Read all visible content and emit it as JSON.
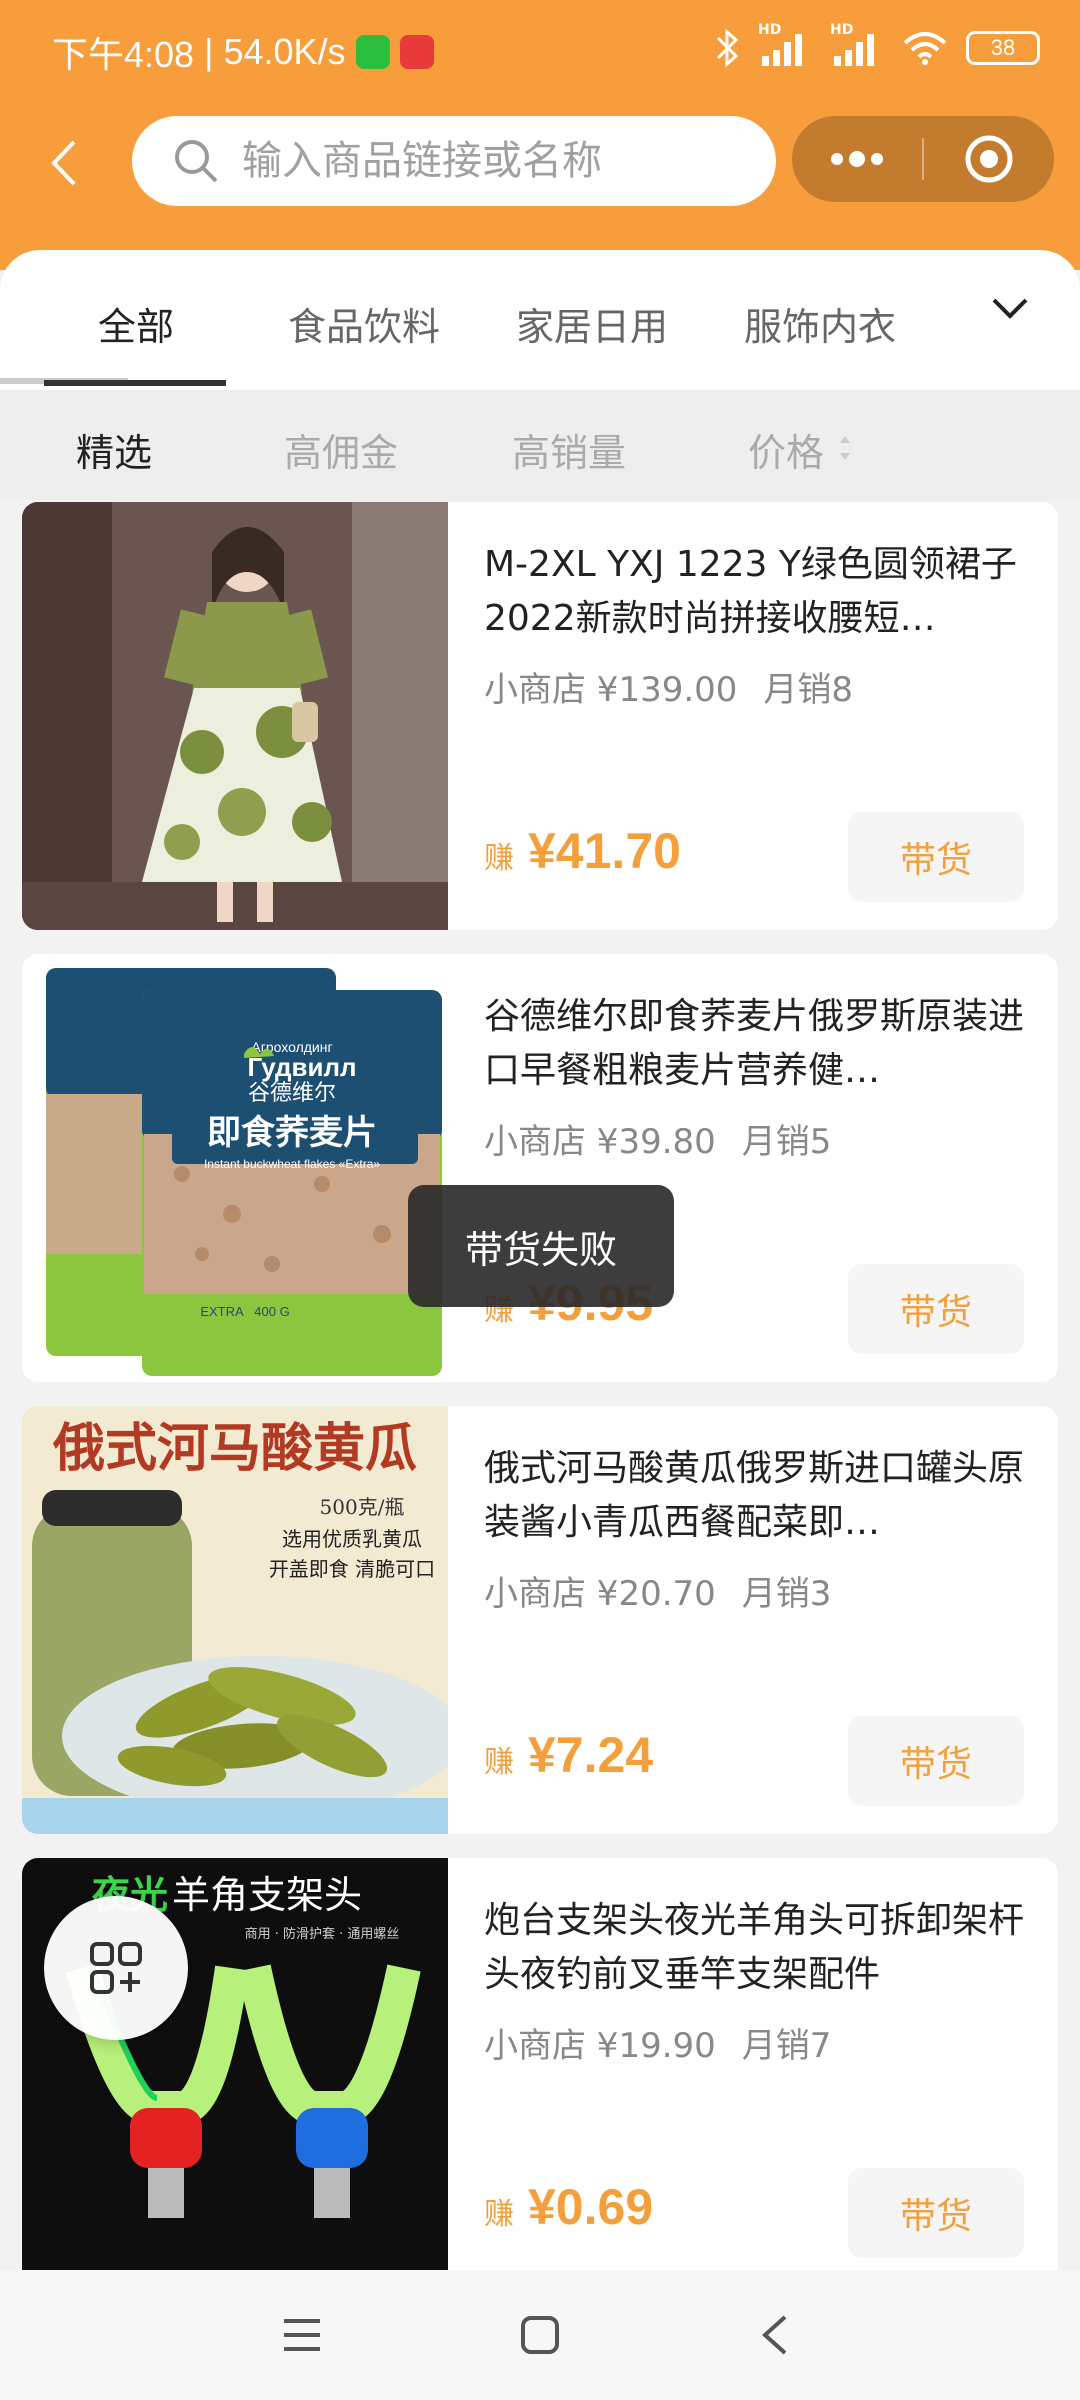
{
  "status_bar": {
    "time": "下午4:08",
    "separator": "|",
    "speed": "54.0K/s",
    "battery": "38",
    "hd1": "HD",
    "hd2": "HD"
  },
  "search": {
    "placeholder": "输入商品链接或名称"
  },
  "category_tabs": [
    {
      "label": "全部",
      "active": true
    },
    {
      "label": "食品饮料",
      "active": false
    },
    {
      "label": "家居日用",
      "active": false
    },
    {
      "label": "服饰内衣",
      "active": false
    }
  ],
  "sort_tabs": [
    {
      "label": "精选",
      "active": true
    },
    {
      "label": "高佣金",
      "active": false
    },
    {
      "label": "高销量",
      "active": false
    },
    {
      "label": "价格",
      "active": false
    }
  ],
  "products": [
    {
      "title": "M-2XL YXJ 1223 Y绿色圆领裙子2022新款时尚拼接收腰短…",
      "shop_price": "小商店 ¥139.00",
      "monthly_sales": "月销8",
      "earn_prefix": "赚",
      "earn": "¥41.70",
      "button": "带货"
    },
    {
      "title": "谷德维尔即食荞麦片俄罗斯原装进口早餐粗粮麦片营养健…",
      "shop_price": "小商店 ¥39.80",
      "monthly_sales": "月销5",
      "earn_prefix": "赚",
      "earn": "¥9.95",
      "button": "带货",
      "image_text": {
        "brand_small": "Агрохолдинг",
        "brand": "Гудвилл",
        "brand_cn": "谷德维尔",
        "product_cn": "即食荞麦片",
        "product_en": "Instant buckwheat flakes «Extra»",
        "extra": "EXTRA",
        "weight": "400 G"
      }
    },
    {
      "title": "俄式河马酸黄瓜俄罗斯进口罐头原装酱小青瓜西餐配菜即…",
      "shop_price": "小商店 ¥20.70",
      "monthly_sales": "月销3",
      "earn_prefix": "赚",
      "earn": "¥7.24",
      "button": "带货",
      "image_text": {
        "headline": "俄式河马酸黄瓜",
        "weight": "500克/瓶",
        "line1": "选用优质乳黄瓜",
        "line2": "开盖即食 清脆可口"
      }
    },
    {
      "title": "炮台支架头夜光羊角头可拆卸架杆头夜钓前叉垂竿支架配件",
      "shop_price": "小商店 ¥19.90",
      "monthly_sales": "月销7",
      "earn_prefix": "赚",
      "earn": "¥0.69",
      "button": "带货",
      "image_text": {
        "headline_green": "夜光",
        "headline_white": "羊角支架头",
        "sub": "商用 · 防滑护套 · 通用螺丝"
      }
    }
  ],
  "toast": "带货失败",
  "colors": {
    "header": "#f79d3c",
    "accent": "#f3a03c"
  }
}
